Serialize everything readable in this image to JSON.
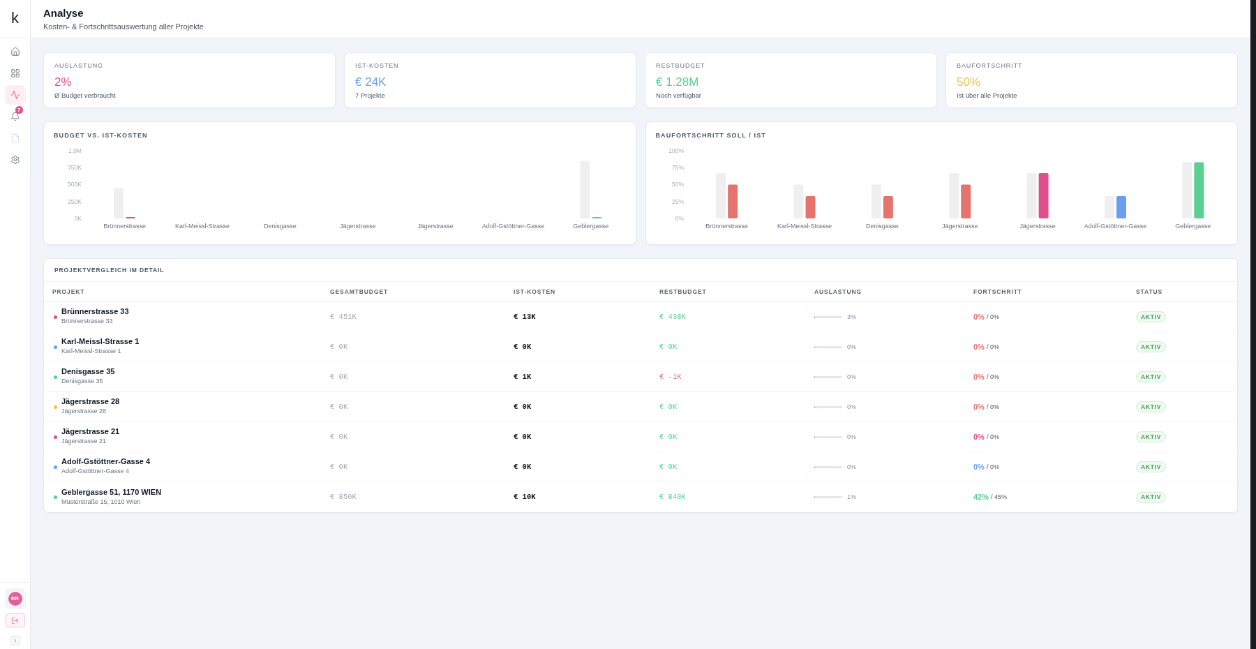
{
  "sidebar": {
    "logo": "k",
    "nav": [
      {
        "kind": "home",
        "selected": false,
        "disabled": false
      },
      {
        "kind": "grid",
        "selected": false,
        "disabled": false
      },
      {
        "kind": "activity",
        "selected": true,
        "disabled": false
      },
      {
        "kind": "bell",
        "selected": false,
        "disabled": false,
        "badge": "7"
      },
      {
        "kind": "file",
        "selected": false,
        "disabled": true
      },
      {
        "kind": "settings",
        "selected": false,
        "disabled": false
      }
    ],
    "avatar": "RR"
  },
  "header": {
    "title": "Analyse",
    "subtitle": "Kosten- & Fortschrittsauswertung aller Projekte"
  },
  "kpis": [
    {
      "label": "AUSLASTUNG",
      "value": "2%",
      "note": "Ø Budget verbraucht",
      "color": "#e5508c"
    },
    {
      "label": "IST-KOSTEN",
      "value": "€ 24K",
      "note": "7 Projekte",
      "color": "#6b9ff0"
    },
    {
      "label": "RESTBUDGET",
      "value": "€ 1.28M",
      "note": "Noch verfügbar",
      "color": "#5fcf94"
    },
    {
      "label": "BAUFORTSCHRITT",
      "value": "50%",
      "note": "Ist über alle Projekte",
      "color": "#f0c04a"
    }
  ],
  "charts": [
    {
      "title": "BUDGET VS. IST-KOSTEN",
      "chart_data": {
        "type": "bar",
        "categories": [
          "Brünnerstrasse",
          "Karl-Meissl-Strasse",
          "Denisgasse",
          "Jägerstrasse",
          "Jägerstrasse",
          "Adolf-Gstöttner-Gasse",
          "Geblergasse"
        ],
        "series": [
          {
            "color": "#efefef",
            "values": [
              450000,
              0,
              0,
              0,
              0,
              0,
              850000
            ]
          },
          {
            "colors": [
              "#e0508c",
              "#6c9ef0",
              "#5ccf93",
              "#f2c14a",
              "#e0508c",
              "#6c9ef0",
              "#5ccf93"
            ],
            "values": [
              10000,
              0,
              0,
              0,
              0,
              0,
              10000
            ]
          }
        ],
        "ylim": [
          0,
          1000000
        ],
        "yticks": [
          {
            "value": 0,
            "label": "0K"
          },
          {
            "value": 250000,
            "label": "250K"
          },
          {
            "value": 500000,
            "label": "500K"
          },
          {
            "value": 750000,
            "label": "750K"
          },
          {
            "value": 1000000,
            "label": "1.0M"
          }
        ]
      }
    },
    {
      "title": "BAUFORTSCHRITT SOLL / IST",
      "chart_data": {
        "type": "bar",
        "categories": [
          "Brünnerstrasse",
          "Karl-Meissl-Strasse",
          "Denisgasse",
          "Jägerstrasse",
          "Jägerstrasse",
          "Adolf-Gstöttner-Gasse",
          "Geblergasse"
        ],
        "series": [
          {
            "color": "#efefef",
            "values": [
              67,
              50,
              50,
              67,
              67,
              33,
              83
            ]
          },
          {
            "colors": [
              "#e5736e",
              "#e5736e",
              "#e5736e",
              "#e5736e",
              "#e0508c",
              "#6c9ef0",
              "#5ccf93"
            ],
            "values": [
              50,
              33,
              33,
              50,
              67,
              33,
              83
            ]
          }
        ],
        "ylim": [
          0,
          100
        ],
        "yticks": [
          {
            "value": 0,
            "label": "0%"
          },
          {
            "value": 25,
            "label": "25%"
          },
          {
            "value": 50,
            "label": "50%"
          },
          {
            "value": 75,
            "label": "75%"
          },
          {
            "value": 100,
            "label": "100%"
          }
        ]
      }
    }
  ],
  "table": {
    "title": "PROJEKTVERGLEICH IM DETAIL",
    "columns": [
      "PROJEKT",
      "GESAMTBUDGET",
      "IST-KOSTEN",
      "RESTBUDGET",
      "AUSLASTUNG",
      "FORTSCHRITT",
      "STATUS"
    ],
    "rows": [
      {
        "name": "Brünnerstrasse 33",
        "address": "Brünnerstrasse 33",
        "color": "#e0508c",
        "budget": "€ 451K",
        "cost": "€ 13K",
        "rest": "€ 438K",
        "rest_negative": false,
        "level": 0.03,
        "usage": "3%",
        "progress": {
          "value": "0%",
          "target": "/ 0%",
          "color": "#e5736e"
        },
        "status": {
          "label": "AKTIV",
          "kind": "active"
        }
      },
      {
        "name": "Karl-Meissl-Strasse 1",
        "address": "Karl-Meissl-Strasse 1",
        "color": "#6c9ef0",
        "budget": "€ 0K",
        "cost": "€ 0K",
        "rest": "€ 0K",
        "rest_negative": false,
        "level": 0,
        "usage": "0%",
        "progress": {
          "value": "0%",
          "target": "/ 0%",
          "color": "#e5736e"
        },
        "status": {
          "label": "AKTIV",
          "kind": "active"
        }
      },
      {
        "name": "Denisgasse 35",
        "address": "Denisgasse 35",
        "color": "#5ccf93",
        "budget": "€ 0K",
        "cost": "€ 1K",
        "rest": "€ -1K",
        "rest_negative": true,
        "level": 0,
        "usage": "0%",
        "progress": {
          "value": "0%",
          "target": "/ 0%",
          "color": "#e5736e"
        },
        "status": {
          "label": "AKTIV",
          "kind": "active"
        }
      },
      {
        "name": "Jägerstrasse 28",
        "address": "Jägerstrasse 28",
        "color": "#f2c14a",
        "budget": "€ 0K",
        "cost": "€ 0K",
        "rest": "€ 0K",
        "rest_negative": false,
        "level": 0,
        "usage": "0%",
        "progress": {
          "value": "0%",
          "target": "/ 0%",
          "color": "#e5736e"
        },
        "status": {
          "label": "AKTIV",
          "kind": "active"
        }
      },
      {
        "name": "Jägerstrasse 21",
        "address": "Jägerstrasse 21",
        "color": "#e0508c",
        "budget": "€ 0K",
        "cost": "€ 0K",
        "rest": "€ 0K",
        "rest_negative": false,
        "level": 0,
        "usage": "0%",
        "progress": {
          "value": "0%",
          "target": "/ 0%",
          "color": "#e0508c"
        },
        "status": {
          "label": "AKTIV",
          "kind": "active"
        }
      },
      {
        "name": "Adolf-Gstöttner-Gasse 4",
        "address": "Adolf-Gstöttner-Gasse 4",
        "color": "#6c9ef0",
        "budget": "€ 0K",
        "cost": "€ 0K",
        "rest": "€ 0K",
        "rest_negative": false,
        "level": 0,
        "usage": "0%",
        "progress": {
          "value": "0%",
          "target": "/ 0%",
          "color": "#6c9ef0"
        },
        "status": {
          "label": "AKTIV",
          "kind": "active"
        }
      },
      {
        "name": "Geblergasse 51, 1170 WIEN",
        "address": "Musterstraße 15, 1010 Wien",
        "color": "#5ccf93",
        "budget": "€ 850K",
        "cost": "€ 10K",
        "rest": "€ 840K",
        "rest_negative": false,
        "level": 0.01,
        "usage": "1%",
        "progress": {
          "value": "42%",
          "target": "/ 45%",
          "color": "#5ccf93"
        },
        "status": {
          "label": "AKTIV",
          "kind": "active"
        }
      }
    ]
  }
}
